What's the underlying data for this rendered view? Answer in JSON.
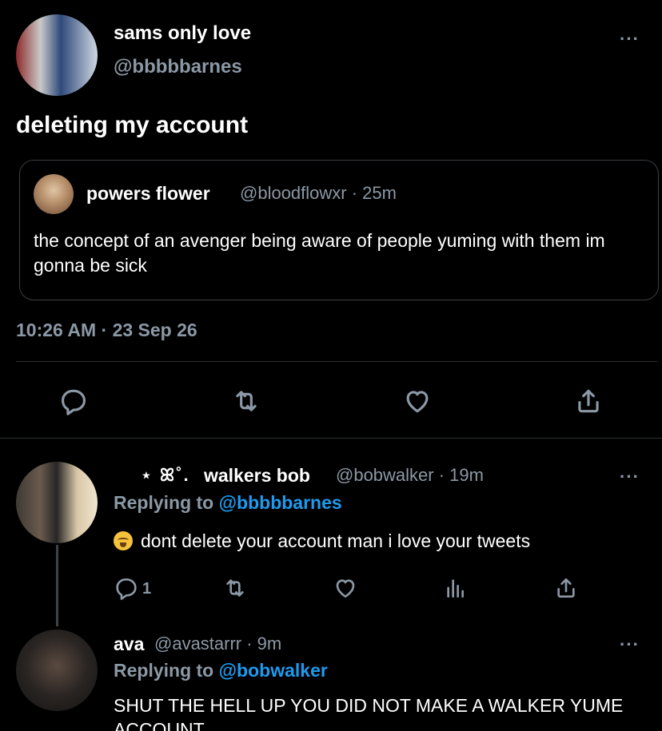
{
  "main_tweet": {
    "display_name": "sams only love",
    "handle": "@bbbbbarnes",
    "text": "deleting my account",
    "timestamp": "10:26 AM · 23 Sep 26",
    "more_label": "···",
    "quoted": {
      "display_name": "powers flower",
      "meta": "@bloodflowxr · 25m",
      "text": "the concept of an avenger being aware of people yuming with them im gonna be sick"
    }
  },
  "replies": [
    {
      "decoration": "⋆ ꕤ˚.",
      "display_name": "walkers bob",
      "meta": "@bobwalker · 19m",
      "replying_prefix": "Replying to ",
      "replying_to": "@bbbbbarnes",
      "text": "dont delete your account man i love your tweets",
      "reply_count": "1",
      "more_label": "···"
    },
    {
      "display_name": "ava",
      "meta": "@avastarrr · 9m",
      "replying_prefix": "Replying to ",
      "replying_to": "@bobwalker",
      "text": "SHUT THE HELL UP YOU DID NOT MAKE A WALKER YUME ACCOUNT",
      "more_label": "···"
    }
  ],
  "colors": {
    "background": "#000000",
    "text": "#e7e9ea",
    "muted": "#8b98a5",
    "link": "#1d9bf0",
    "divider": "#2f3336"
  },
  "icons": [
    "reply-icon",
    "retweet-icon",
    "like-icon",
    "share-icon",
    "analytics-icon",
    "more-icon"
  ]
}
